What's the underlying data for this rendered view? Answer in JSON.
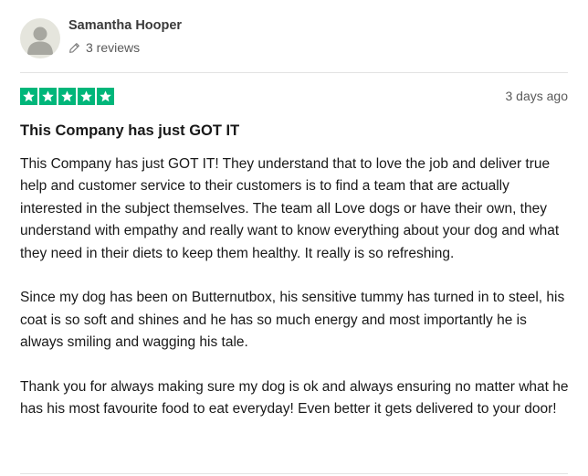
{
  "reviewer": {
    "name": "Samantha Hooper",
    "reviews_count": "3 reviews",
    "avatar_icon": "default-user-icon",
    "reviews_icon": "pencil-icon"
  },
  "review": {
    "rating": 5,
    "rating_max": 5,
    "star_color": "#00b67a",
    "date": "3 days ago",
    "title": "This Company has just GOT IT",
    "paragraphs": [
      "This Company has just GOT IT! They understand that to love the job and deliver true help and customer service to their customers is to find a team that are actually interested in the subject themselves. The team all Love dogs or have their own, they understand with empathy and really want to know everything about your dog and what they need in their diets to keep them healthy. It really is so refreshing.",
      "Since my dog has been on Butternutbox, his sensitive tummy has turned in to steel, his coat is so soft and shines and he has so much energy and most importantly he is always smiling and wagging his tale.",
      "Thank you for always making sure my dog is ok and always ensuring no matter what he has his most favourite food to eat everyday! Even better it gets delivered to your door!"
    ]
  }
}
